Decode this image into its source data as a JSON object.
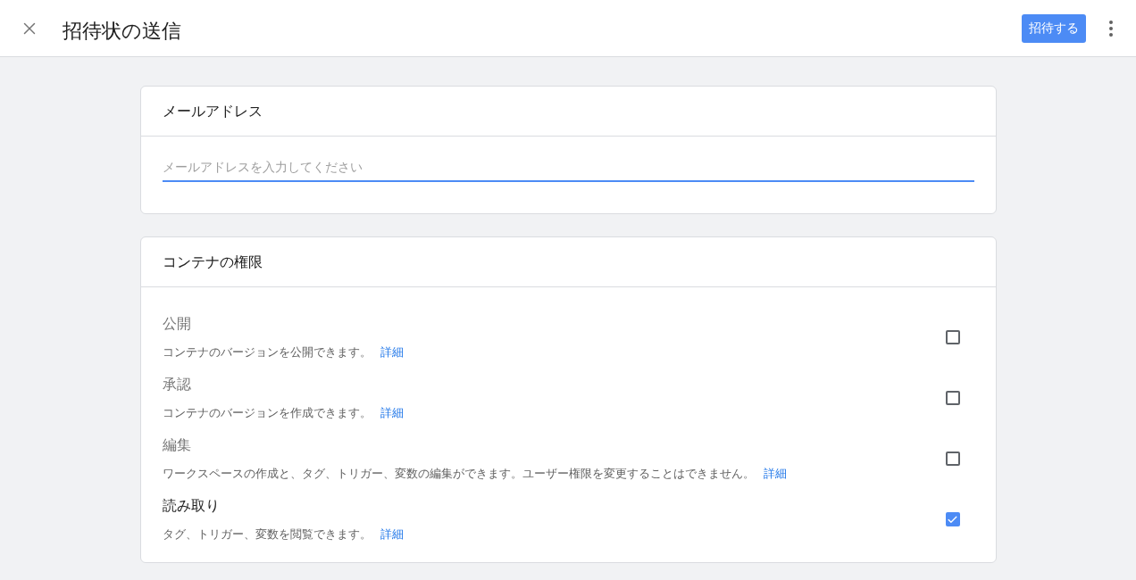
{
  "header": {
    "title": "招待状の送信",
    "invite_button": "招待する"
  },
  "email_card": {
    "title": "メールアドレス",
    "placeholder": "メールアドレスを入力してください"
  },
  "permissions_card": {
    "title": "コンテナの権限",
    "items": [
      {
        "title": "公開",
        "description": "コンテナのバージョンを公開できます。",
        "link": "詳細",
        "checked": false
      },
      {
        "title": "承認",
        "description": "コンテナのバージョンを作成できます。",
        "link": "詳細",
        "checked": false
      },
      {
        "title": "編集",
        "description": "ワークスペースの作成と、タグ、トリガー、変数の編集ができます。ユーザー権限を変更することはできません。",
        "link": "詳細",
        "checked": false
      },
      {
        "title": "読み取り",
        "description": "タグ、トリガー、変数を閲覧できます。",
        "link": "詳細",
        "checked": true
      }
    ]
  }
}
